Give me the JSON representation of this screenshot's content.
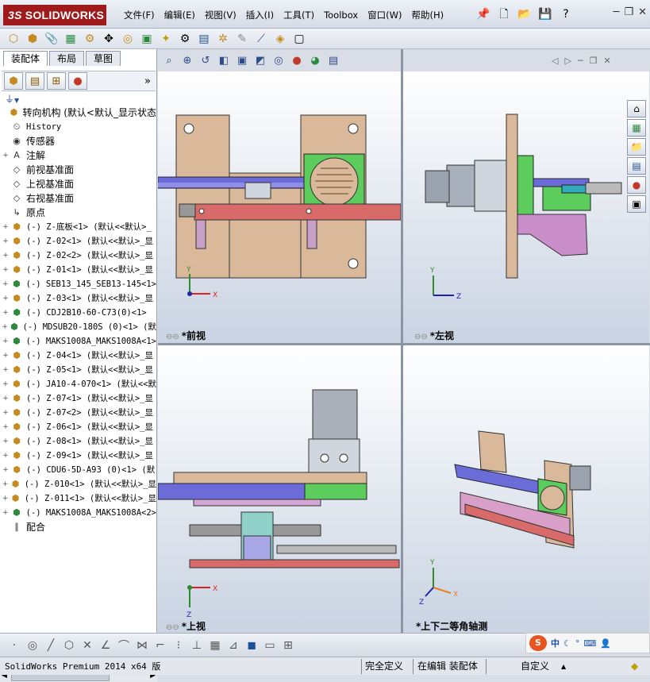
{
  "app": {
    "logo": "SOLIDWORKS",
    "logo_prefix": "3S"
  },
  "menu": [
    "文件(F)",
    "编辑(E)",
    "视图(V)",
    "插入(I)",
    "工具(T)",
    "Toolbox",
    "窗口(W)",
    "帮助(H)"
  ],
  "left_panel": {
    "tabs": [
      "装配体",
      "布局",
      "草图"
    ],
    "expand_glyph": "»",
    "filter_glyph": "▼"
  },
  "tree": [
    {
      "expand": "",
      "icon": "asm",
      "text": "转向机构  (默认<默认_显示状态",
      "top": true
    },
    {
      "expand": "",
      "icon": "history",
      "text": "History"
    },
    {
      "expand": "",
      "icon": "sensor",
      "text": "传感器",
      "top": true
    },
    {
      "expand": "+",
      "icon": "annotation",
      "text": "注解",
      "top": true
    },
    {
      "expand": "",
      "icon": "plane",
      "text": "前视基准面",
      "top": true
    },
    {
      "expand": "",
      "icon": "plane",
      "text": "上视基准面",
      "top": true
    },
    {
      "expand": "",
      "icon": "plane",
      "text": "右视基准面",
      "top": true
    },
    {
      "expand": "",
      "icon": "origin",
      "text": "原点",
      "top": true
    },
    {
      "expand": "+",
      "icon": "part",
      "text": "(-) Z-底板<1> (默认<<默认>_"
    },
    {
      "expand": "+",
      "icon": "part",
      "text": "(-) Z-02<1> (默认<<默认>_显"
    },
    {
      "expand": "+",
      "icon": "part",
      "text": "(-) Z-02<2> (默认<<默认>_显"
    },
    {
      "expand": "+",
      "icon": "part",
      "text": "(-) Z-01<1> (默认<<默认>_显"
    },
    {
      "expand": "+",
      "icon": "green",
      "text": "(-) SEB13_145_SEB13-145<1>"
    },
    {
      "expand": "+",
      "icon": "part",
      "text": "(-) Z-03<1> (默认<<默认>_显"
    },
    {
      "expand": "+",
      "icon": "green",
      "text": "(-) CDJ2B10-60-C73(0)<1>"
    },
    {
      "expand": "+",
      "icon": "green",
      "text": "(-) MDSUB20-180S (0)<1> (默"
    },
    {
      "expand": "+",
      "icon": "green",
      "text": "(-) MAKS1008A_MAKS1008A<1>"
    },
    {
      "expand": "+",
      "icon": "part",
      "text": "(-) Z-04<1> (默认<<默认>_显"
    },
    {
      "expand": "+",
      "icon": "part",
      "text": "(-) Z-05<1> (默认<<默认>_显"
    },
    {
      "expand": "+",
      "icon": "part",
      "text": "(-) JA10-4-070<1> (默认<<默"
    },
    {
      "expand": "+",
      "icon": "part",
      "text": "(-) Z-07<1> (默认<<默认>_显"
    },
    {
      "expand": "+",
      "icon": "part",
      "text": "(-) Z-07<2> (默认<<默认>_显"
    },
    {
      "expand": "+",
      "icon": "part",
      "text": "(-) Z-06<1> (默认<<默认>_显"
    },
    {
      "expand": "+",
      "icon": "part",
      "text": "(-) Z-08<1> (默认<<默认>_显"
    },
    {
      "expand": "+",
      "icon": "part",
      "text": "(-) Z-09<1> (默认<<默认>_显"
    },
    {
      "expand": "+",
      "icon": "part",
      "text": "(-) CDU6-5D-A93 (0)<1> (默"
    },
    {
      "expand": "+",
      "icon": "part",
      "text": "(-) Z-010<1> (默认<<默认>_显"
    },
    {
      "expand": "+",
      "icon": "part",
      "text": "(-) Z-011<1> (默认<<默认>_显"
    },
    {
      "expand": "+",
      "icon": "green",
      "text": "(-) MAKS1008A_MAKS1008A<2>"
    },
    {
      "expand": "",
      "icon": "mate",
      "text": "配合",
      "top": true
    }
  ],
  "viewports": {
    "front": {
      "label": "*前视"
    },
    "left": {
      "label": "*左视"
    },
    "top": {
      "label": "*上视"
    },
    "iso": {
      "label": "*上下二等角轴测"
    }
  },
  "axes": {
    "x": "X",
    "y": "Y",
    "z": "Z"
  },
  "ime": {
    "logo": "S",
    "lang": "中"
  },
  "status": {
    "version": "SolidWorks Premium 2014 x64 版",
    "definition": "完全定义",
    "editing": "在编辑 装配体",
    "units": "自定义",
    "arrow": "▲"
  }
}
